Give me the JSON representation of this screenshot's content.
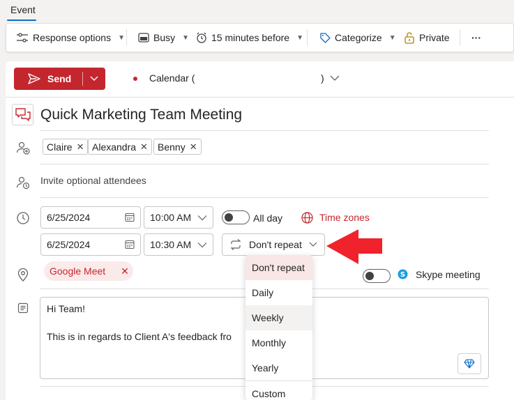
{
  "tab": {
    "label": "Event"
  },
  "toolbar": {
    "response_options": "Response options",
    "busy": "Busy",
    "reminder": "15 minutes before",
    "categorize": "Categorize",
    "private": "Private",
    "more": "···"
  },
  "send": {
    "label": "Send"
  },
  "calendar": {
    "label": "Calendar (",
    "close": ")"
  },
  "event": {
    "title": "Quick Marketing Team Meeting"
  },
  "attendees": {
    "required": [
      {
        "name": "Claire"
      },
      {
        "name": "Alexandra"
      },
      {
        "name": "Benny"
      }
    ],
    "optional_placeholder": "Invite optional attendees"
  },
  "schedule": {
    "start_date": "6/25/2024",
    "start_time": "10:00 AM",
    "end_date": "6/25/2024",
    "end_time": "10:30 AM",
    "all_day_label": "All day",
    "time_zones_label": "Time zones",
    "repeat_value": "Don't repeat"
  },
  "location": {
    "value": "Google Meet",
    "skype_label": "Skype meeting"
  },
  "body": {
    "line1": "Hi Team!",
    "line2": "This is in regards to Client A's feedback fro"
  },
  "repeat_menu": {
    "options": [
      "Don't repeat",
      "Daily",
      "Weekly",
      "Monthly",
      "Yearly",
      "Custom"
    ]
  },
  "colors": {
    "accent": "#c4262e",
    "brand_blue": "#0f6cbd"
  }
}
